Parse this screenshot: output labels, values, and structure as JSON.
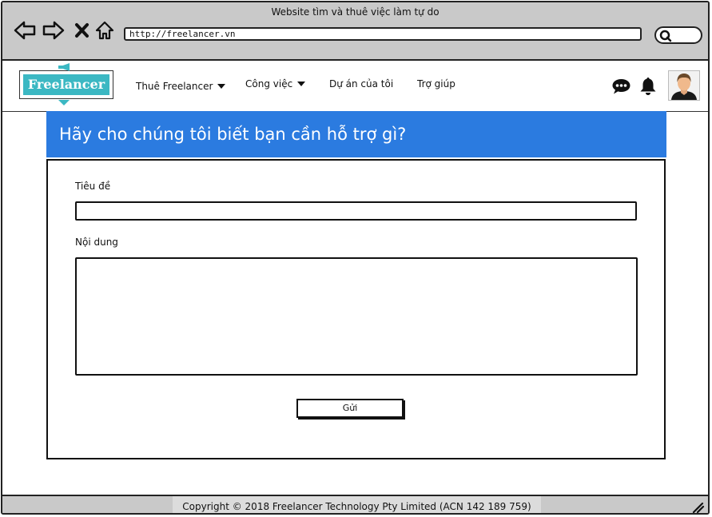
{
  "window": {
    "title": "Website tìm và thuê việc làm tự do"
  },
  "browser": {
    "url": "http://freelancer.vn",
    "icons": [
      "back-icon",
      "forward-icon",
      "close-icon",
      "home-icon",
      "search-icon"
    ]
  },
  "header": {
    "logo_text": "Freelancer",
    "menu": [
      {
        "label": "Thuê Freelancer",
        "has_dropdown": true
      },
      {
        "label": "Công việc",
        "has_dropdown": true
      },
      {
        "label": "Dự án của tôi",
        "has_dropdown": false
      },
      {
        "label": "Trợ giúp",
        "has_dropdown": false
      }
    ],
    "icons": [
      "chat-icon",
      "bell-icon",
      "avatar"
    ]
  },
  "main": {
    "heading": "Hãy cho chúng tôi biết bạn cần hỗ trợ gì?",
    "form": {
      "title_label": "Tiêu đề",
      "title_value": "",
      "content_label": "Nội dung",
      "content_value": "",
      "submit_label": "Gửi"
    }
  },
  "footer": {
    "copyright": "Copyright © 2018 Freelancer Technology Pty Limited (ACN 142 189 759)"
  },
  "colors": {
    "banner": "#2b7be0",
    "logo": "#3bb8c3",
    "chrome": "#c9c9c9"
  }
}
